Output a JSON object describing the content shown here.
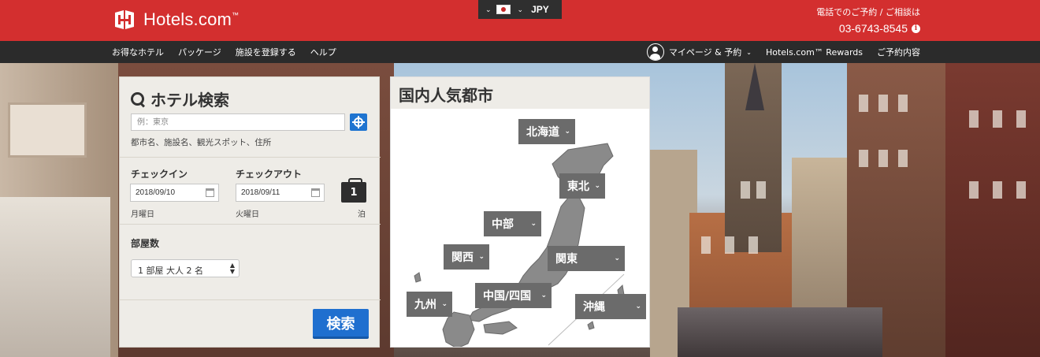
{
  "header": {
    "logo_text": "Hotels.com",
    "logo_tm": "™",
    "locale_currency": "JPY",
    "phone_label": "電話でのご予約 / ご相談は",
    "phone_number": "03-6743-8545",
    "info_glyph": "i",
    "brand_color": "#d32f2f"
  },
  "nav": {
    "left": [
      "お得なホテル",
      "パッケージ",
      "施設を登録する",
      "ヘルプ"
    ],
    "my_page": "マイページ & 予約",
    "rewards": "Hotels.com™ Rewards",
    "bookings": "ご予約内容"
  },
  "search": {
    "title": "ホテル検索",
    "destination_placeholder": "例：東京",
    "destination_hint": "都市名、施設名、観光スポット、住所",
    "checkin_label": "チェックイン",
    "checkout_label": "チェックアウト",
    "checkin_date": "2018/09/10",
    "checkout_date": "2018/09/11",
    "checkin_day": "月曜日",
    "checkout_day": "火曜日",
    "nights": "1",
    "nights_unit": "泊",
    "rooms_label": "部屋数",
    "rooms_value": "1 部屋 大人 2 名",
    "submit_label": "検索",
    "button_color": "#1f6fcf"
  },
  "cities": {
    "title": "国内人気都市",
    "regions": [
      {
        "id": "hokkaido",
        "label": "北海道"
      },
      {
        "id": "tohoku",
        "label": "東北"
      },
      {
        "id": "chubu",
        "label": "中部"
      },
      {
        "id": "kansai",
        "label": "関西"
      },
      {
        "id": "kanto",
        "label": "関東"
      },
      {
        "id": "chugoku-shikoku",
        "label": "中国/四国"
      },
      {
        "id": "kyushu",
        "label": "九州"
      },
      {
        "id": "okinawa",
        "label": "沖縄"
      }
    ]
  }
}
